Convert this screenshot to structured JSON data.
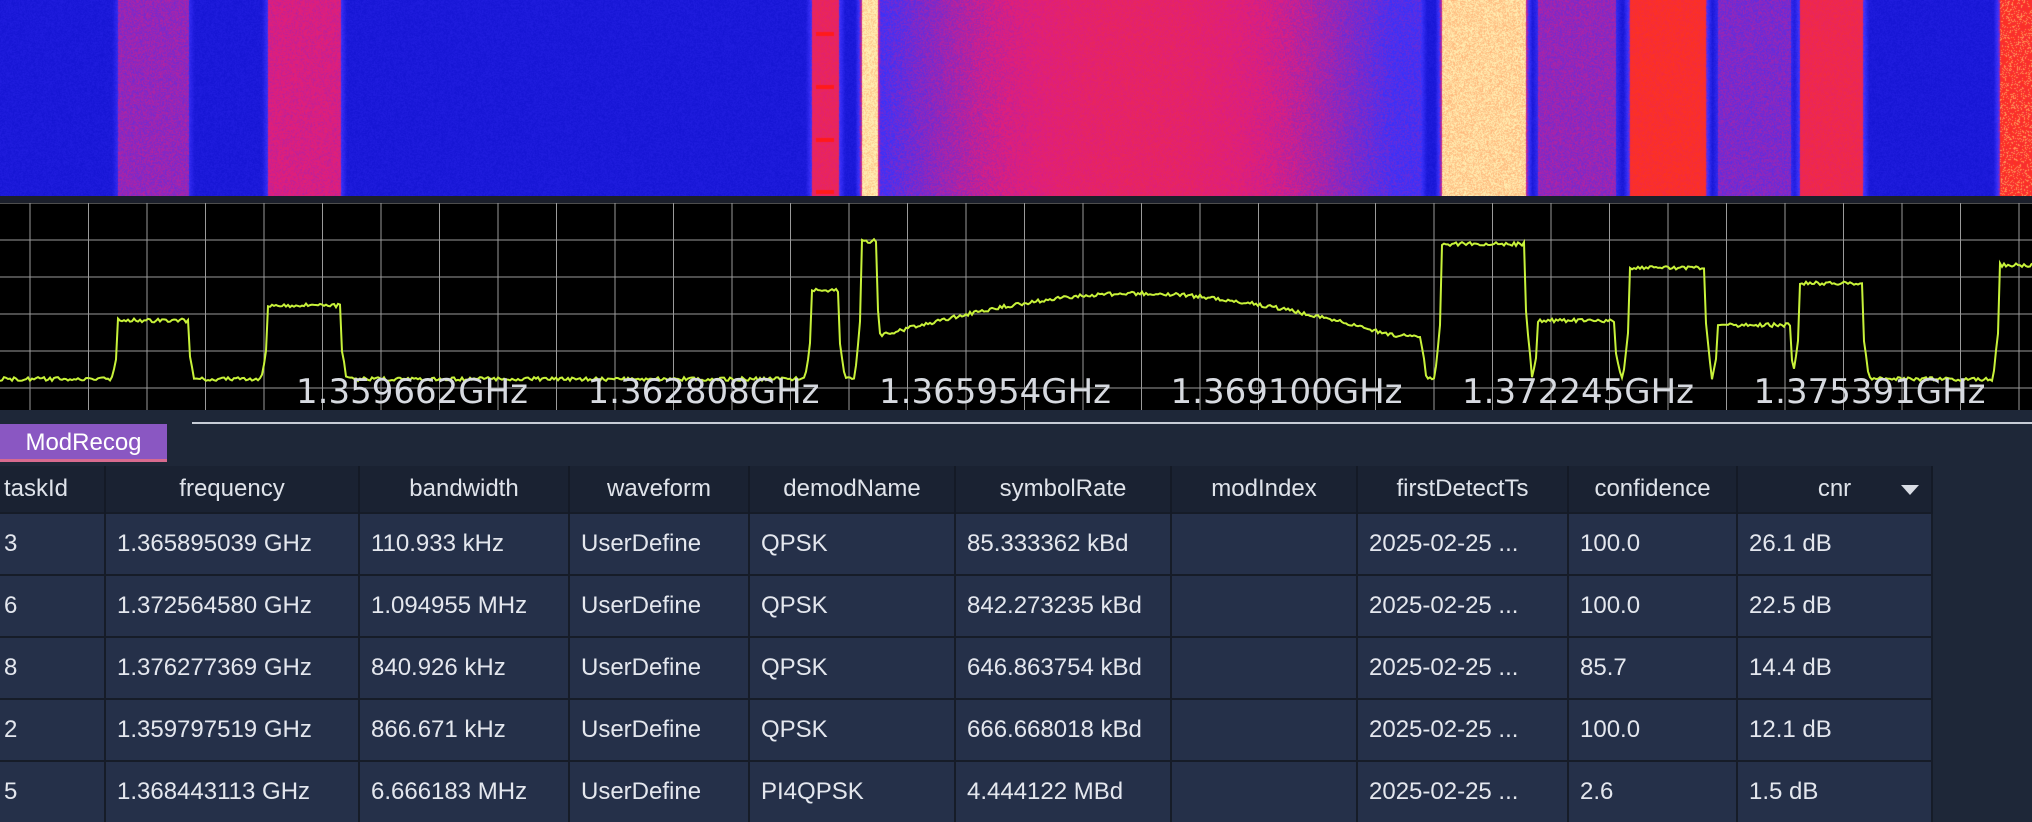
{
  "spectrum": {
    "freq_labels": [
      "1.359662GHz",
      "1.362808GHz",
      "1.365954GHz",
      "1.369100GHz",
      "1.372245GHz",
      "1.375391GHz"
    ],
    "trace_color": "#c8f23a",
    "grid_color": "#9a9a9a"
  },
  "tabs": [
    {
      "label": "ModRecog",
      "color": "#8a57c2"
    }
  ],
  "table": {
    "columns": [
      "taskId",
      "frequency",
      "bandwidth",
      "waveform",
      "demodName",
      "symbolRate",
      "modIndex",
      "firstDetectTs",
      "confidence",
      "cnr"
    ],
    "sorted_column": "cnr",
    "rows": [
      [
        "3",
        "1.365895039 GHz",
        "110.933 kHz",
        "UserDefine",
        "QPSK",
        "85.333362 kBd",
        "",
        "2025-02-25 ...",
        "100.0",
        "26.1 dB"
      ],
      [
        "6",
        "1.372564580 GHz",
        "1.094955 MHz",
        "UserDefine",
        "QPSK",
        "842.273235 kBd",
        "",
        "2025-02-25 ...",
        "100.0",
        "22.5 dB"
      ],
      [
        "8",
        "1.376277369 GHz",
        "840.926 kHz",
        "UserDefine",
        "QPSK",
        "646.863754 kBd",
        "",
        "2025-02-25 ...",
        "85.7",
        "14.4 dB"
      ],
      [
        "2",
        "1.359797519 GHz",
        "866.671 kHz",
        "UserDefine",
        "QPSK",
        "666.668018 kBd",
        "",
        "2025-02-25 ...",
        "100.0",
        "12.1 dB"
      ],
      [
        "5",
        "1.368443113 GHz",
        "6.666183 MHz",
        "UserDefine",
        "PI4QPSK",
        "4.444122 MBd",
        "",
        "2025-02-25 ...",
        "2.6",
        "1.5 dB"
      ]
    ]
  }
}
